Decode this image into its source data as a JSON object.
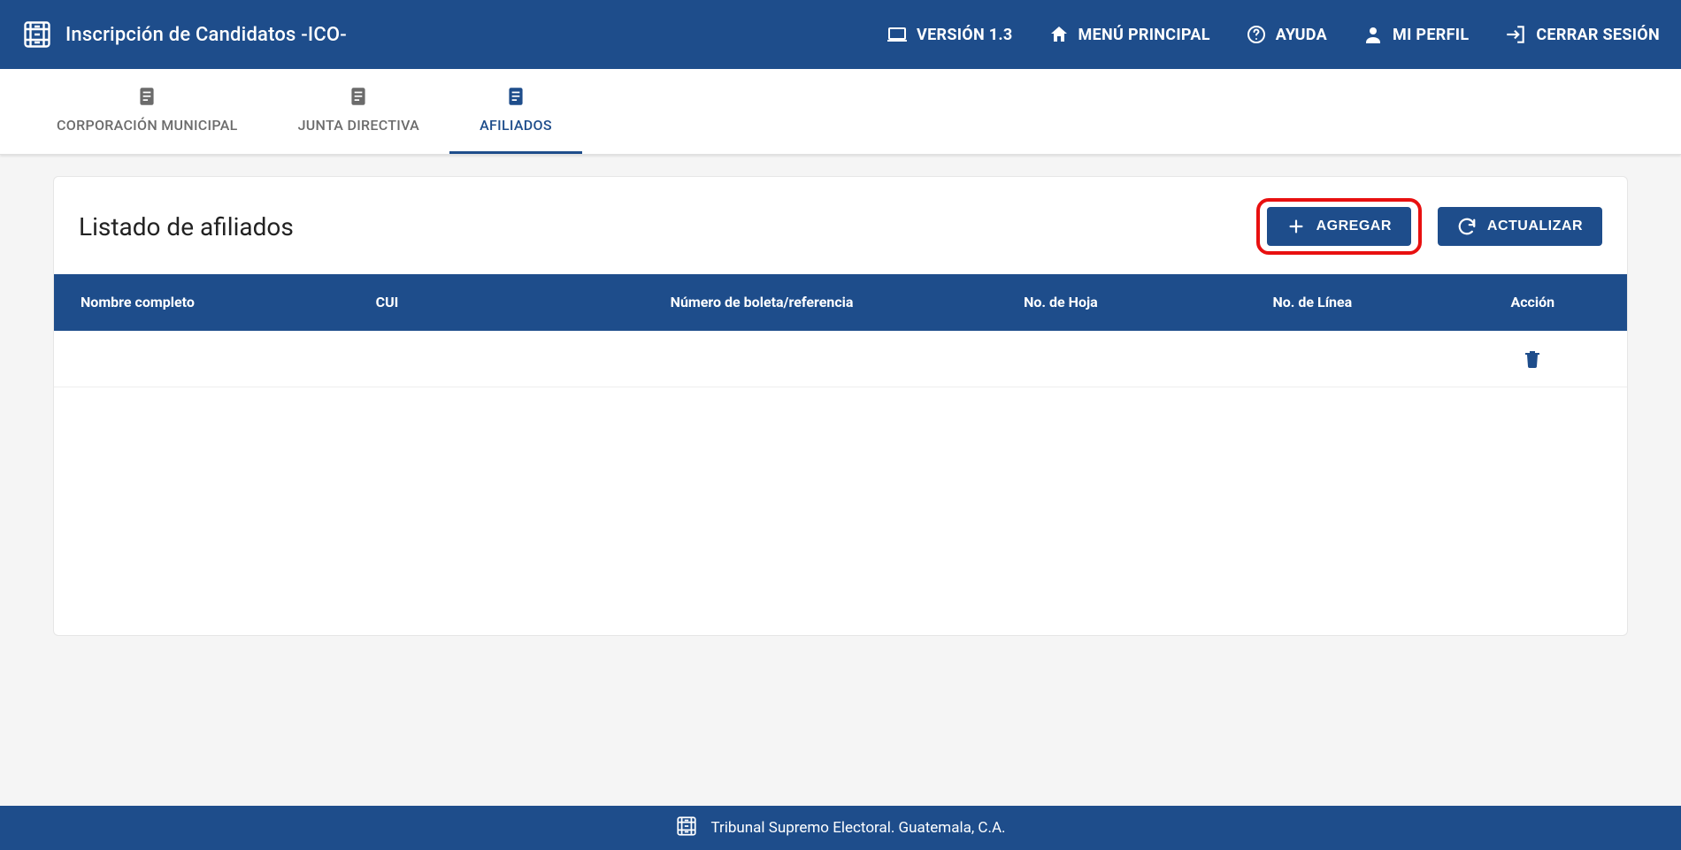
{
  "header": {
    "app_title": "Inscripción de Candidatos -ICO-",
    "nav": {
      "version": "VERSIÓN 1.3",
      "menu_principal": "MENÚ PRINCIPAL",
      "ayuda": "AYUDA",
      "mi_perfil": "MI PERFIL",
      "cerrar_sesion": "CERRAR SESIÓN"
    }
  },
  "tabs": {
    "corporacion": "CORPORACIÓN MUNICIPAL",
    "junta": "JUNTA DIRECTIVA",
    "afiliados": "AFILIADOS"
  },
  "card": {
    "title": "Listado de afiliados",
    "agregar": "AGREGAR",
    "actualizar": "ACTUALIZAR"
  },
  "table": {
    "headers": {
      "nombre": "Nombre completo",
      "cui": "CUI",
      "boleta": "Número de boleta/referencia",
      "hoja": "No. de Hoja",
      "linea": "No. de Línea",
      "accion": "Acción"
    },
    "rows": [
      {
        "nombre": "",
        "cui": "",
        "boleta": "",
        "hoja": "",
        "linea": ""
      }
    ]
  },
  "footer": {
    "text": "Tribunal Supremo Electoral. Guatemala, C.A."
  },
  "highlight": {
    "agregar_button": true
  }
}
